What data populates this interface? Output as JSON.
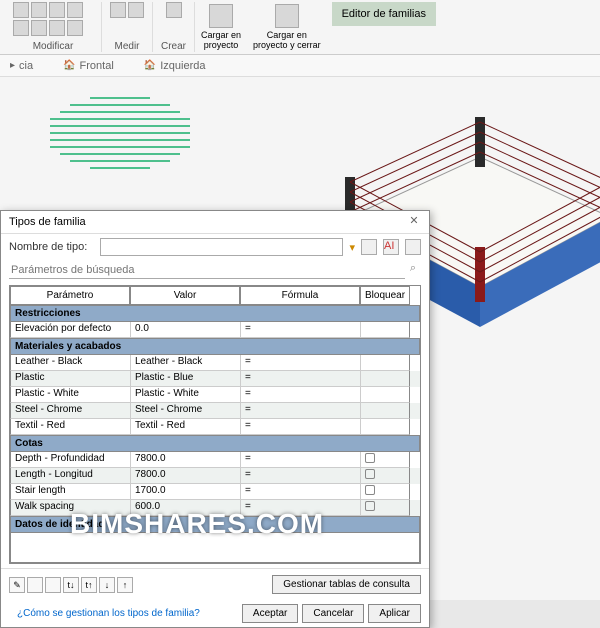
{
  "ribbon": {
    "modificar": "Modificar",
    "medir": "Medir",
    "crear": "Crear",
    "cargar1": "Cargar en",
    "cargar1b": "proyecto",
    "cargar2": "Cargar en",
    "cargar2b": "proyecto y cerrar",
    "editor": "Editor de familias"
  },
  "viewbar": {
    "ref": "cia",
    "frontal": "Frontal",
    "izq": "Izquierda"
  },
  "dialog": {
    "title": "Tipos de familia",
    "nombre_label": "Nombre de tipo:",
    "nombre_value": "",
    "search_label": "Parámetros de búsqueda",
    "col_param": "Parámetro",
    "col_valor": "Valor",
    "col_formula": "Fórmula",
    "col_lock": "Bloquear",
    "sec_restr": "Restricciones",
    "elev_label": "Elevación por defecto",
    "elev_val": "0.0",
    "sec_mat": "Materiales y acabados",
    "mat": [
      {
        "p": "Leather - Black",
        "v": "Leather - Black"
      },
      {
        "p": "Plastic",
        "v": "Plastic - Blue"
      },
      {
        "p": "Plastic - White",
        "v": "Plastic - White"
      },
      {
        "p": "Steel - Chrome",
        "v": "Steel - Chrome"
      },
      {
        "p": "Textil - Red",
        "v": "Textil - Red"
      }
    ],
    "sec_cotas": "Cotas",
    "cotas": [
      {
        "p": "Depth - Profundidad",
        "v": "7800.0"
      },
      {
        "p": "Length - Longitud",
        "v": "7800.0"
      },
      {
        "p": "Stair length",
        "v": "1700.0"
      },
      {
        "p": "Walk spacing",
        "v": "600.0"
      }
    ],
    "sec_ident": "Datos de identidad",
    "gestionar": "Gestionar tablas de consulta",
    "help": "¿Cómo se gestionan los tipos de familia?",
    "aceptar": "Aceptar",
    "cancelar": "Cancelar",
    "aplicar": "Aplicar"
  },
  "watermark": "BIMSHARES.COM"
}
